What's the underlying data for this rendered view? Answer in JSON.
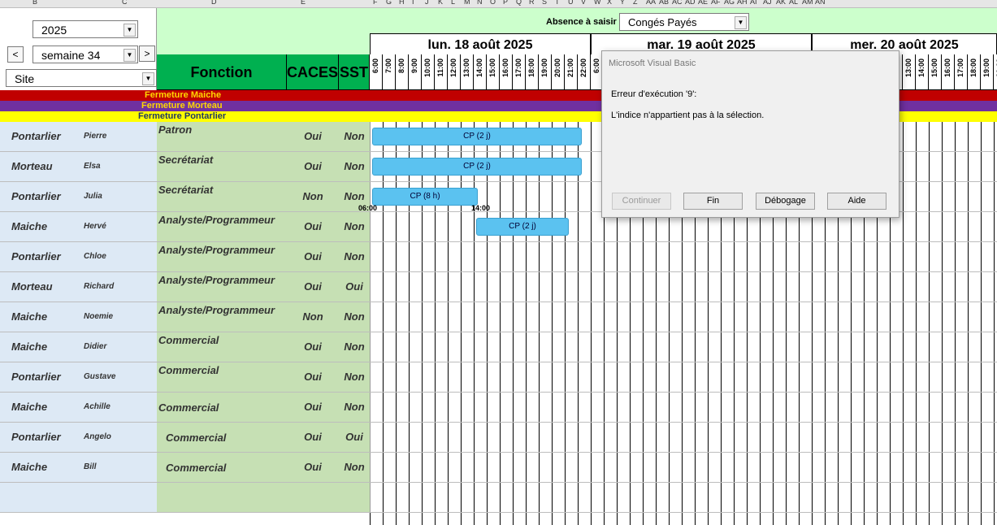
{
  "column_letters": [
    "B",
    "C",
    "D",
    "E",
    "F",
    "G",
    "H",
    "I",
    "J",
    "K",
    "L",
    "M",
    "N",
    "O",
    "P",
    "Q",
    "R",
    "S",
    "T",
    "U",
    "V",
    "W",
    "X",
    "Y",
    "Z",
    "AA",
    "AB",
    "AC",
    "AD",
    "AE",
    "AF",
    "AG",
    "AH",
    "AI",
    "AJ",
    "AK",
    "AL",
    "AM",
    "AN"
  ],
  "controls": {
    "year": "2025",
    "week": "semaine 34",
    "prev_label": "<",
    "next_label": ">",
    "site_filter": "Site"
  },
  "absence": {
    "label": "Absence à saisir :",
    "value": "Congés Payés"
  },
  "headers": {
    "fonction": "Fonction",
    "caces": "CACES",
    "sst": "SST"
  },
  "days": [
    "lun. 18 août 2025",
    "mar. 19 août 2025",
    "mer. 20 août 2025"
  ],
  "hours": [
    "6:00",
    "7:00",
    "8:00",
    "9:00",
    "10:00",
    "11:00",
    "12:00",
    "13:00",
    "14:00",
    "15:00",
    "16:00",
    "17:00",
    "18:00",
    "19:00",
    "20:00",
    "21:00",
    "22:00"
  ],
  "banners": [
    {
      "label": "Fermeture Maiche",
      "bg": "#c00000",
      "fg": "#ffd700"
    },
    {
      "label": "Fermeture Morteau",
      "bg": "#7030a0",
      "fg": "#ffd700"
    },
    {
      "label": "Fermeture Pontarlier",
      "bg": "#ffff00",
      "fg": "#1f3864"
    }
  ],
  "rows": [
    {
      "site": "Pontarlier",
      "name": "Pierre",
      "fonction": "Patron",
      "caces": "Oui",
      "sst": "Non"
    },
    {
      "site": "Morteau",
      "name": "Elsa",
      "fonction": "Secrétariat",
      "caces": "Oui",
      "sst": "Non"
    },
    {
      "site": "Pontarlier",
      "name": "Julia",
      "fonction": "Secrétariat",
      "caces": "Non",
      "sst": "Non"
    },
    {
      "site": "Maiche",
      "name": "Hervé",
      "fonction": "Analyste/Programmeur",
      "caces": "Oui",
      "sst": "Non"
    },
    {
      "site": "Pontarlier",
      "name": "Chloe",
      "fonction": "Analyste/Programmeur",
      "caces": "Oui",
      "sst": "Non"
    },
    {
      "site": "Morteau",
      "name": "Richard",
      "fonction": "Analyste/Programmeur",
      "caces": "Oui",
      "sst": "Oui"
    },
    {
      "site": "Maiche",
      "name": "Noemie",
      "fonction": "Analyste/Programmeur",
      "caces": "Non",
      "sst": "Non"
    },
    {
      "site": "Maiche",
      "name": "Didier",
      "fonction": "Commercial",
      "caces": "Oui",
      "sst": "Non"
    },
    {
      "site": "Pontarlier",
      "name": "Gustave",
      "fonction": "Commercial",
      "caces": "Oui",
      "sst": "Non"
    },
    {
      "site": "Maiche",
      "name": "Achille",
      "fonction": "Commercial",
      "caces": "Oui",
      "sst": "Non"
    },
    {
      "site": "Pontarlier",
      "name": "Angelo",
      "fonction": "Commercial",
      "caces": "Oui",
      "sst": "Oui"
    },
    {
      "site": "Maiche",
      "name": "Bill",
      "fonction": "Commercial",
      "caces": "Oui",
      "sst": "Non"
    },
    {
      "site": "",
      "name": "",
      "fonction": "",
      "caces": "",
      "sst": ""
    }
  ],
  "absences": [
    {
      "label": "CP (2 j)"
    },
    {
      "label": "CP (2 j)"
    },
    {
      "label": "CP (8 h)",
      "start_label": "06:00",
      "end_label": "14:00"
    },
    {
      "label": "CP (2 j)"
    }
  ],
  "dialog": {
    "title": "Microsoft Visual Basic",
    "error_line": "Erreur d'exécution '9':",
    "message": "L'indice n'appartient pas à la sélection.",
    "btn_continue": "Continuer",
    "btn_end": "Fin",
    "btn_debug": "Débogage",
    "btn_help": "Aide"
  }
}
